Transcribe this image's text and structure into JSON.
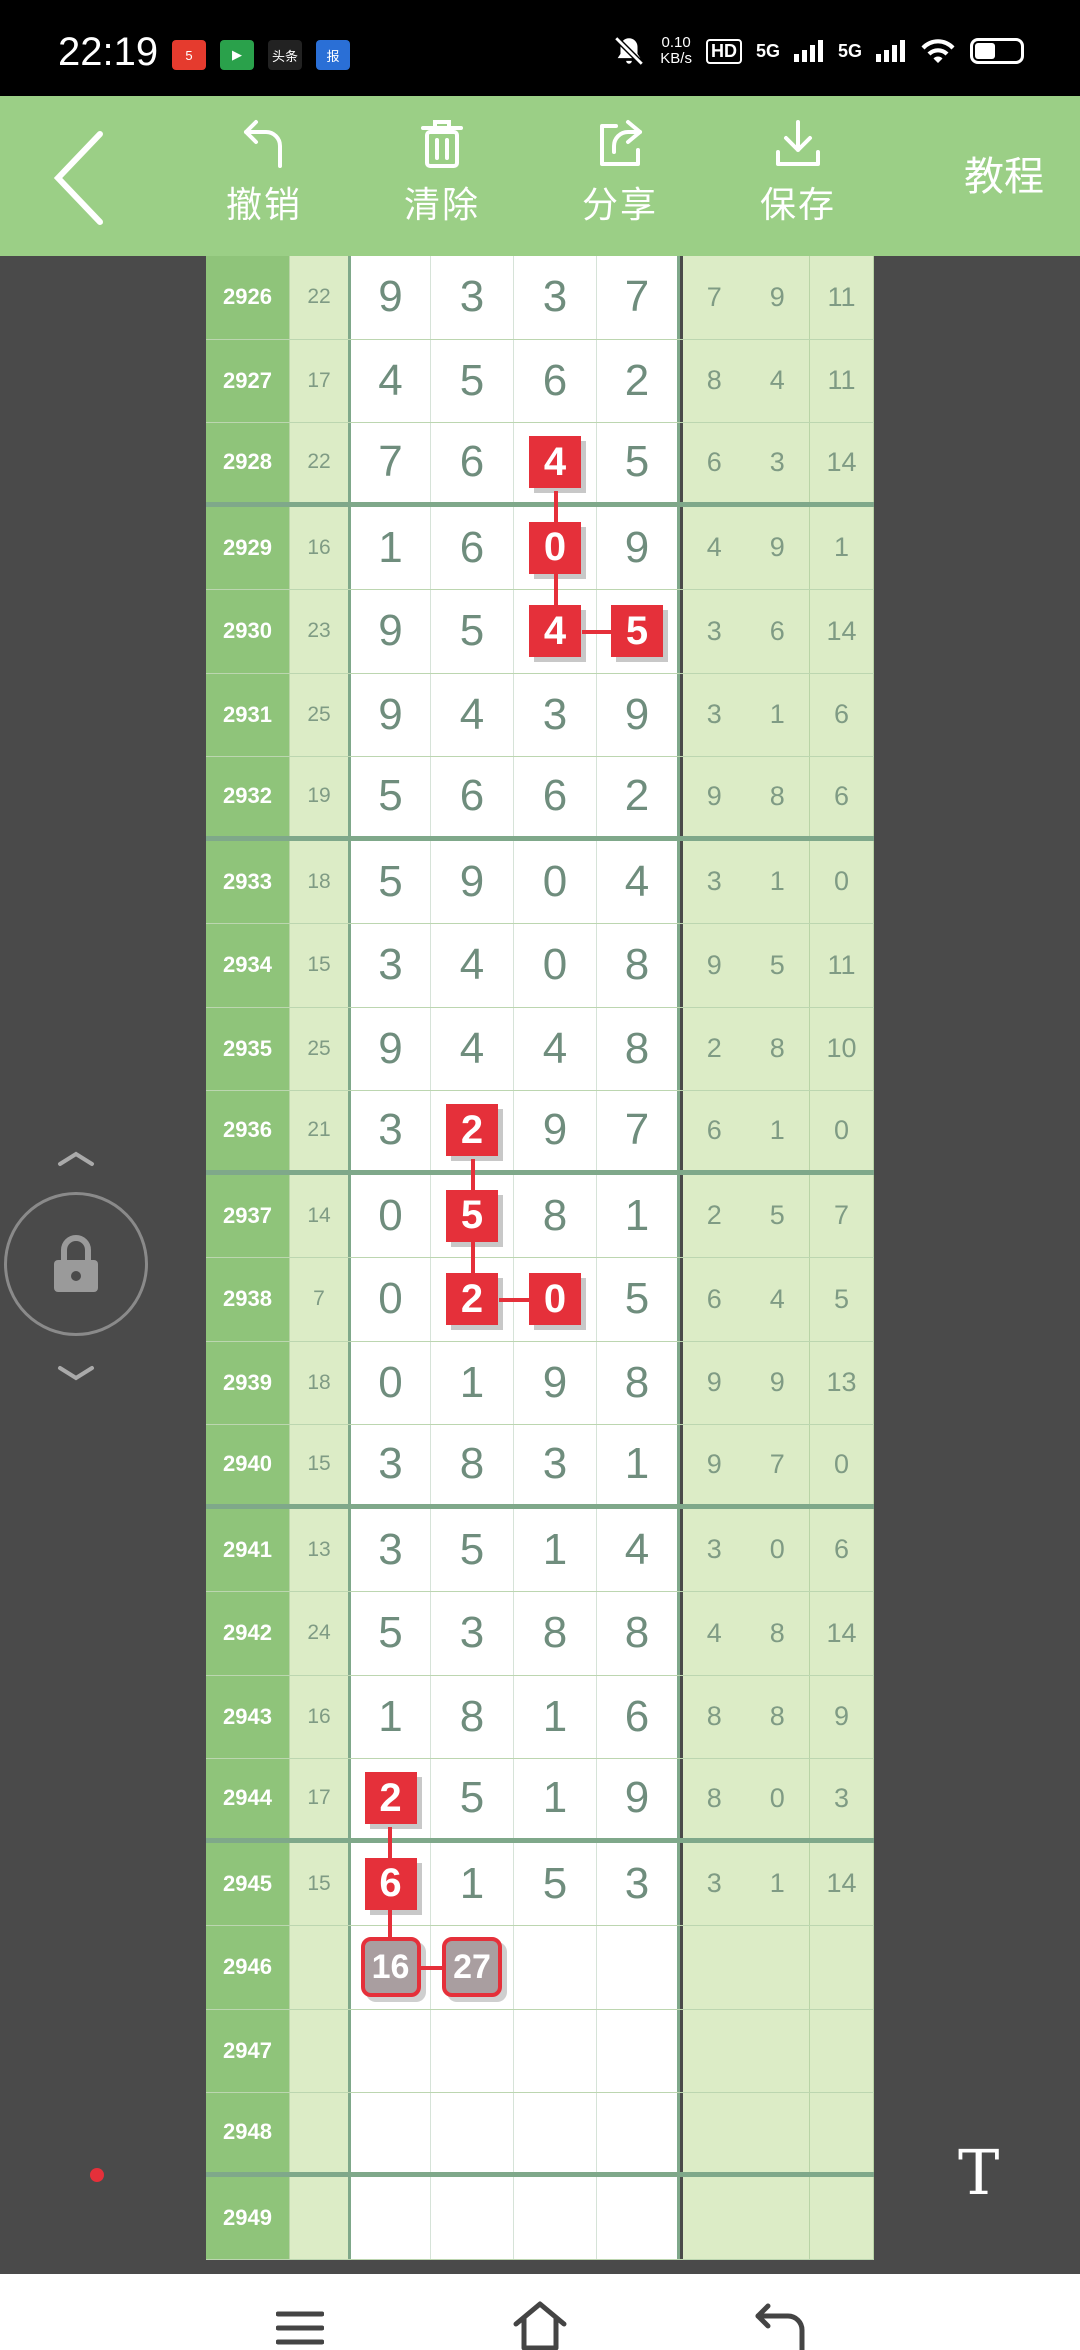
{
  "status": {
    "time": "22:19",
    "speed_top": "0.10",
    "speed_bottom": "KB/s",
    "hd": "HD",
    "net1": "5G",
    "net2": "5G",
    "apps": [
      {
        "name": "5",
        "color": "#e53b2e"
      },
      {
        "name": "▶",
        "color": "#2aa14b"
      },
      {
        "name": "头条",
        "color": "#222222"
      },
      {
        "name": "报",
        "color": "#2a6fd6"
      }
    ]
  },
  "toolbar": {
    "undo_label": "撤销",
    "clear_label": "清除",
    "share_label": "分享",
    "save_label": "保存",
    "tutorial_label": "教程"
  },
  "table": {
    "rows": [
      {
        "issue": "2926",
        "sum": "22",
        "digits": [
          "9",
          "3",
          "3",
          "7"
        ],
        "stats": [
          "7",
          "9",
          "11"
        ]
      },
      {
        "issue": "2927",
        "sum": "17",
        "digits": [
          "4",
          "5",
          "6",
          "2"
        ],
        "stats": [
          "8",
          "4",
          "11"
        ]
      },
      {
        "issue": "2928",
        "sum": "22",
        "digits": [
          "7",
          "6",
          "4",
          "5"
        ],
        "stats": [
          "6",
          "3",
          "14"
        ]
      },
      {
        "issue": "2929",
        "sum": "16",
        "digits": [
          "1",
          "6",
          "0",
          "9"
        ],
        "stats": [
          "4",
          "9",
          "1"
        ]
      },
      {
        "issue": "2930",
        "sum": "23",
        "digits": [
          "9",
          "5",
          "4",
          "5"
        ],
        "stats": [
          "3",
          "6",
          "14"
        ]
      },
      {
        "issue": "2931",
        "sum": "25",
        "digits": [
          "9",
          "4",
          "3",
          "9"
        ],
        "stats": [
          "3",
          "1",
          "6"
        ]
      },
      {
        "issue": "2932",
        "sum": "19",
        "digits": [
          "5",
          "6",
          "6",
          "2"
        ],
        "stats": [
          "9",
          "8",
          "6"
        ]
      },
      {
        "issue": "2933",
        "sum": "18",
        "digits": [
          "5",
          "9",
          "0",
          "4"
        ],
        "stats": [
          "3",
          "1",
          "0"
        ]
      },
      {
        "issue": "2934",
        "sum": "15",
        "digits": [
          "3",
          "4",
          "0",
          "8"
        ],
        "stats": [
          "9",
          "5",
          "11"
        ]
      },
      {
        "issue": "2935",
        "sum": "25",
        "digits": [
          "9",
          "4",
          "4",
          "8"
        ],
        "stats": [
          "2",
          "8",
          "10"
        ]
      },
      {
        "issue": "2936",
        "sum": "21",
        "digits": [
          "3",
          "2",
          "9",
          "7"
        ],
        "stats": [
          "6",
          "1",
          "0"
        ]
      },
      {
        "issue": "2937",
        "sum": "14",
        "digits": [
          "0",
          "5",
          "8",
          "1"
        ],
        "stats": [
          "2",
          "5",
          "7"
        ]
      },
      {
        "issue": "2938",
        "sum": "7",
        "digits": [
          "0",
          "2",
          "0",
          "5"
        ],
        "stats": [
          "6",
          "4",
          "5"
        ]
      },
      {
        "issue": "2939",
        "sum": "18",
        "digits": [
          "0",
          "1",
          "9",
          "8"
        ],
        "stats": [
          "9",
          "9",
          "13"
        ]
      },
      {
        "issue": "2940",
        "sum": "15",
        "digits": [
          "3",
          "8",
          "3",
          "1"
        ],
        "stats": [
          "9",
          "7",
          "0"
        ]
      },
      {
        "issue": "2941",
        "sum": "13",
        "digits": [
          "3",
          "5",
          "1",
          "4"
        ],
        "stats": [
          "3",
          "0",
          "6"
        ]
      },
      {
        "issue": "2942",
        "sum": "24",
        "digits": [
          "5",
          "3",
          "8",
          "8"
        ],
        "stats": [
          "4",
          "8",
          "14"
        ]
      },
      {
        "issue": "2943",
        "sum": "16",
        "digits": [
          "1",
          "8",
          "1",
          "6"
        ],
        "stats": [
          "8",
          "8",
          "9"
        ]
      },
      {
        "issue": "2944",
        "sum": "17",
        "digits": [
          "2",
          "5",
          "1",
          "9"
        ],
        "stats": [
          "8",
          "0",
          "3"
        ]
      },
      {
        "issue": "2945",
        "sum": "15",
        "digits": [
          "6",
          "1",
          "5",
          "3"
        ],
        "stats": [
          "3",
          "1",
          "14"
        ]
      },
      {
        "issue": "2946",
        "sum": "",
        "digits": [
          "16",
          "27",
          "",
          ""
        ],
        "stats": [
          "",
          "",
          ""
        ]
      },
      {
        "issue": "2947",
        "sum": "",
        "digits": [
          "",
          "",
          "",
          ""
        ],
        "stats": [
          "",
          "",
          ""
        ]
      },
      {
        "issue": "2948",
        "sum": "",
        "digits": [
          "",
          "",
          "",
          ""
        ],
        "stats": [
          "",
          "",
          ""
        ]
      },
      {
        "issue": "2949",
        "sum": "",
        "digits": [
          "",
          "",
          "",
          ""
        ],
        "stats": [
          "",
          "",
          ""
        ]
      }
    ],
    "separator_after": [
      "2928",
      "2932",
      "2936",
      "2940",
      "2944",
      "2948"
    ],
    "highlights": [
      {
        "row": 2,
        "col": 2,
        "type": "red"
      },
      {
        "row": 3,
        "col": 2,
        "type": "red"
      },
      {
        "row": 4,
        "col": 2,
        "type": "red"
      },
      {
        "row": 4,
        "col": 3,
        "type": "red"
      },
      {
        "row": 10,
        "col": 1,
        "type": "red"
      },
      {
        "row": 11,
        "col": 1,
        "type": "red"
      },
      {
        "row": 12,
        "col": 1,
        "type": "red"
      },
      {
        "row": 12,
        "col": 2,
        "type": "red"
      },
      {
        "row": 18,
        "col": 0,
        "type": "red"
      },
      {
        "row": 19,
        "col": 0,
        "type": "red"
      },
      {
        "row": 20,
        "col": 0,
        "type": "grey"
      },
      {
        "row": 20,
        "col": 1,
        "type": "grey"
      }
    ]
  },
  "side": {
    "text_tool_label": "T"
  },
  "colors": {
    "toolbar": "#9bcf86",
    "highlight": "#e5303a",
    "issue_col": "#8fc47a"
  }
}
